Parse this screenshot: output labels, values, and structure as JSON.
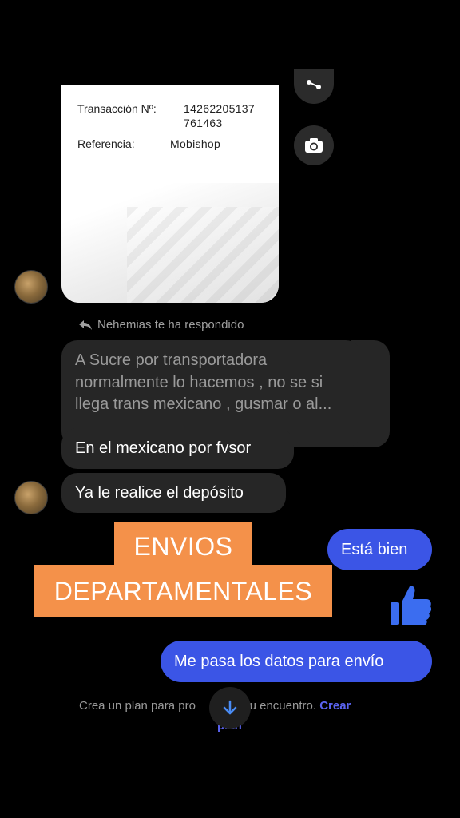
{
  "receipt": {
    "transaction_label": "Transacción Nº:",
    "transaction_value_line1": "14262205137",
    "transaction_value_line2": "761463",
    "reference_label": "Referencia:",
    "reference_value": "Mobishop"
  },
  "reply_note": "Nehemias te ha respondido",
  "quoted_message": {
    "line1": "A Sucre por transportadora",
    "line2": "normalmente lo hacemos , no se si",
    "line3": "llega trans mexicano , gusmar o al..."
  },
  "messages_in": [
    "En el mexicano por fvsor",
    "Ya le realice el depósito"
  ],
  "messages_out": [
    "Está bien",
    "Me pasa los datos para envío"
  ],
  "overlay": {
    "line1": "ENVIOS",
    "line2": "DEPARTAMENTALES",
    "color": "#f4914a"
  },
  "footer": {
    "text": "Crea un plan para pro",
    "text_after": "ar tu encuentro.",
    "link": "Crear",
    "link_cont": "plan"
  },
  "icons": [
    "share-icon",
    "camera-icon",
    "like-thumb-icon",
    "scroll-down-arrow-icon",
    "reply-arrow-icon"
  ],
  "colors": {
    "outgoing_bubble": "#3b55e6",
    "incoming_bubble": "#262626",
    "like": "#3b6df0"
  }
}
